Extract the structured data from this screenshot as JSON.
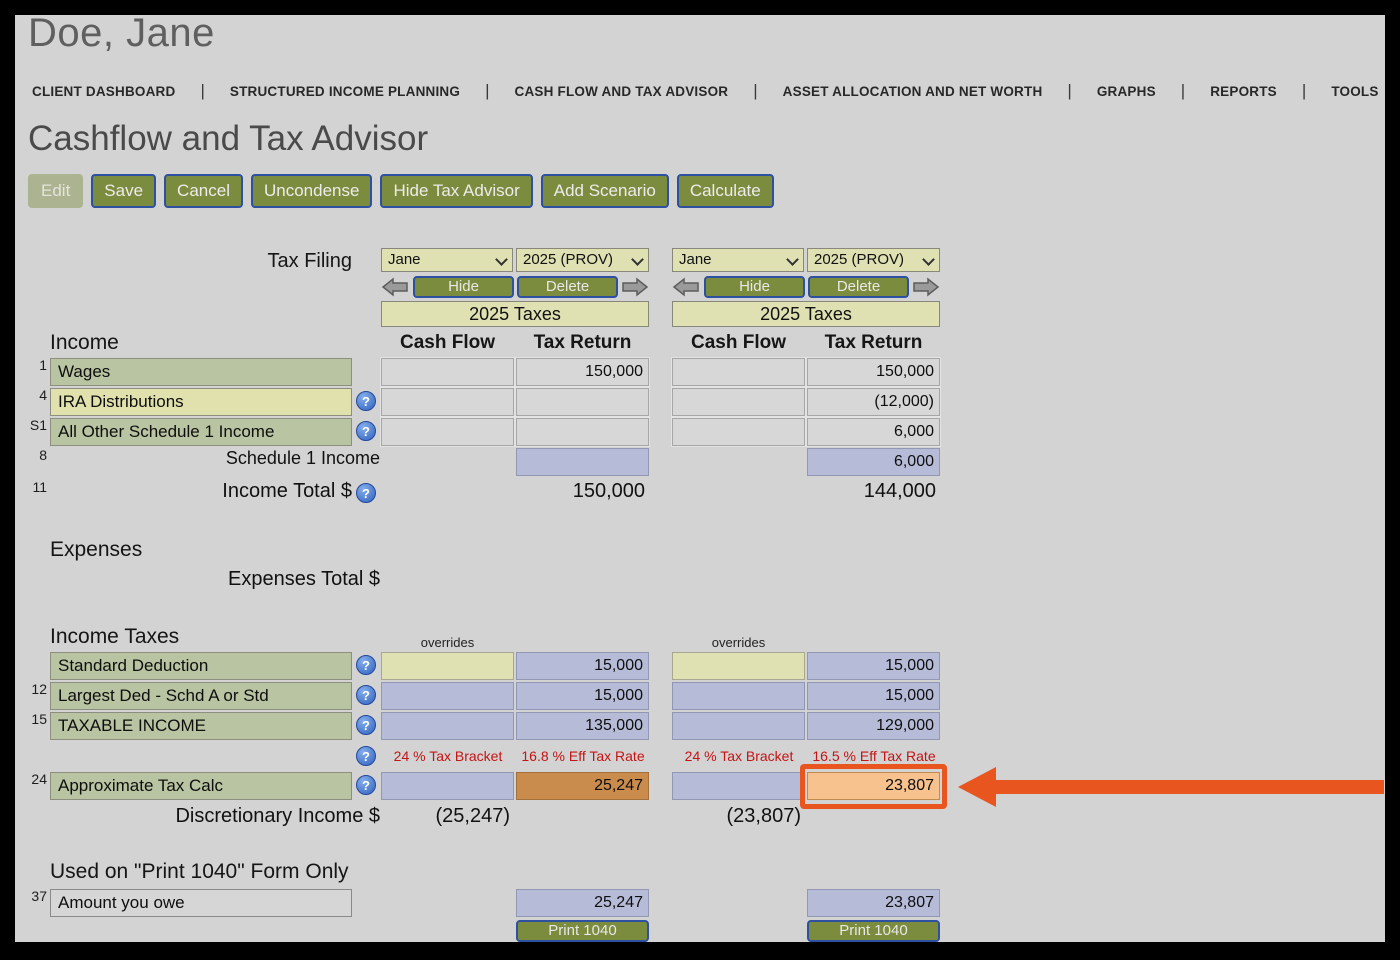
{
  "colors": {
    "page_background": "#d3d3d3",
    "accent_olive": "#7c8c3e",
    "button_border_blue": "#2d50a0",
    "pale_yellow_cell": "#dfe1b3",
    "sage_label": "#b9c4a2",
    "computed_cell_blue": "#b6bcd8",
    "tax_cell_orange": "#c98c4d",
    "highlight_cell_orange": "#f7c28d",
    "annotation_orange": "#e8551f",
    "red_text": "#c41414"
  },
  "client": {
    "name": "Doe, Jane"
  },
  "nav": {
    "separator": "|",
    "items": [
      {
        "label": "CLIENT DASHBOARD"
      },
      {
        "label": "STRUCTURED INCOME PLANNING"
      },
      {
        "label": "CASH FLOW AND TAX ADVISOR"
      },
      {
        "label": "ASSET ALLOCATION AND NET WORTH"
      },
      {
        "label": "GRAPHS"
      },
      {
        "label": "REPORTS"
      },
      {
        "label": "TOOLS"
      }
    ]
  },
  "page": {
    "title": "Cashflow and Tax Advisor"
  },
  "toolbar": {
    "edit": "Edit",
    "save": "Save",
    "cancel": "Cancel",
    "uncondense": "Uncondense",
    "hide_tax_advisor": "Hide Tax Advisor",
    "add_scenario": "Add Scenario",
    "calculate": "Calculate"
  },
  "tax_filing": {
    "label": "Tax Filing",
    "hide": "Hide",
    "delete": "Delete",
    "col_cash_flow": "Cash Flow",
    "col_tax_return": "Tax Return",
    "scenarios": [
      {
        "person": "Jane",
        "year": "2025 (PROV)",
        "taxes_header": "2025 Taxes"
      },
      {
        "person": "Jane",
        "year": "2025 (PROV)",
        "taxes_header": "2025 Taxes"
      }
    ]
  },
  "income": {
    "heading": "Income",
    "rows": [
      {
        "num": "1",
        "label": "Wages",
        "s1_cf": "",
        "s1_tr": "150,000",
        "s2_cf": "",
        "s2_tr": "150,000"
      },
      {
        "num": "4",
        "label": "IRA Distributions",
        "s1_cf": "",
        "s1_tr": "",
        "s2_cf": "",
        "s2_tr": "(12,000)"
      },
      {
        "num": "S1",
        "label": "All Other Schedule 1 Income",
        "s1_cf": "",
        "s1_tr": "",
        "s2_cf": "",
        "s2_tr": "6,000"
      }
    ],
    "schedule1": {
      "num": "8",
      "label": "Schedule 1 Income",
      "s1_tr": "",
      "s2_tr": "6,000"
    },
    "total": {
      "num": "11",
      "label": "Income Total $",
      "s1": "150,000",
      "s2": "144,000"
    }
  },
  "expenses": {
    "heading": "Expenses",
    "total_label": "Expenses Total $"
  },
  "income_taxes": {
    "heading": "Income Taxes",
    "overrides_label": "overrides",
    "rows": [
      {
        "num": "",
        "label": "Standard Deduction",
        "s1_tr": "15,000",
        "s2_tr": "15,000"
      },
      {
        "num": "12",
        "label": "Largest Ded - Schd A or Std",
        "s1_tr": "15,000",
        "s2_tr": "15,000"
      },
      {
        "num": "15",
        "label": "TAXABLE INCOME",
        "s1_tr": "135,000",
        "s2_tr": "129,000"
      }
    ],
    "brackets": {
      "s1_bracket": "24 % Tax Bracket",
      "s1_rate": "16.8 % Eff Tax Rate",
      "s2_bracket": "24 % Tax Bracket",
      "s2_rate": "16.5 % Eff Tax Rate"
    },
    "approx": {
      "num": "24",
      "label": "Approximate Tax Calc",
      "s1_tr": "25,247",
      "s2_tr": "23,807"
    },
    "discretionary": {
      "label": "Discretionary Income $",
      "s1": "(25,247)",
      "s2": "(23,807)"
    }
  },
  "print1040": {
    "heading": "Used on \"Print 1040\" Form Only",
    "row": {
      "num": "37",
      "label": "Amount you owe",
      "s1": "25,247",
      "s2": "23,807"
    },
    "button": "Print 1040"
  }
}
